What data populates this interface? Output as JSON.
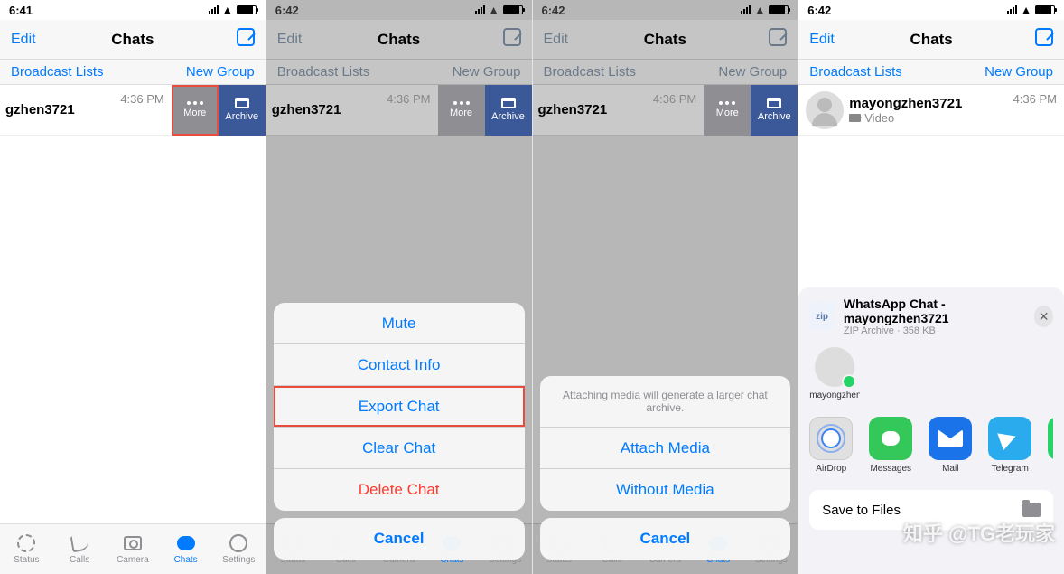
{
  "status": {
    "time1": "6:41",
    "time2": "6:42"
  },
  "nav": {
    "edit": "Edit",
    "title": "Chats"
  },
  "subbar": {
    "broadcast": "Broadcast Lists",
    "newgroup": "New Group"
  },
  "chat": {
    "name": "gzhen3721",
    "name_full": "mayongzhen3721",
    "time": "4:36 PM",
    "preview": "Video"
  },
  "swipe": {
    "more": "More",
    "archive": "Archive"
  },
  "tabs": {
    "status": "Status",
    "calls": "Calls",
    "camera": "Camera",
    "chats": "Chats",
    "settings": "Settings"
  },
  "sheet1": {
    "mute": "Mute",
    "contact": "Contact Info",
    "export": "Export Chat",
    "clear": "Clear Chat",
    "delete": "Delete Chat",
    "cancel": "Cancel"
  },
  "sheet2": {
    "note": "Attaching media will generate a larger chat archive.",
    "attach": "Attach Media",
    "without": "Without Media",
    "cancel": "Cancel"
  },
  "share": {
    "zip": "zip",
    "title": "WhatsApp Chat - mayongzhen3721",
    "sub": "ZIP Archive · 358 KB",
    "contact": "mayongzhen…",
    "apps": {
      "airdrop": "AirDrop",
      "messages": "Messages",
      "mail": "Mail",
      "telegram": "Telegram",
      "whatsapp": "W"
    },
    "save": "Save to Files"
  },
  "watermark": "知乎 @TG老玩家"
}
